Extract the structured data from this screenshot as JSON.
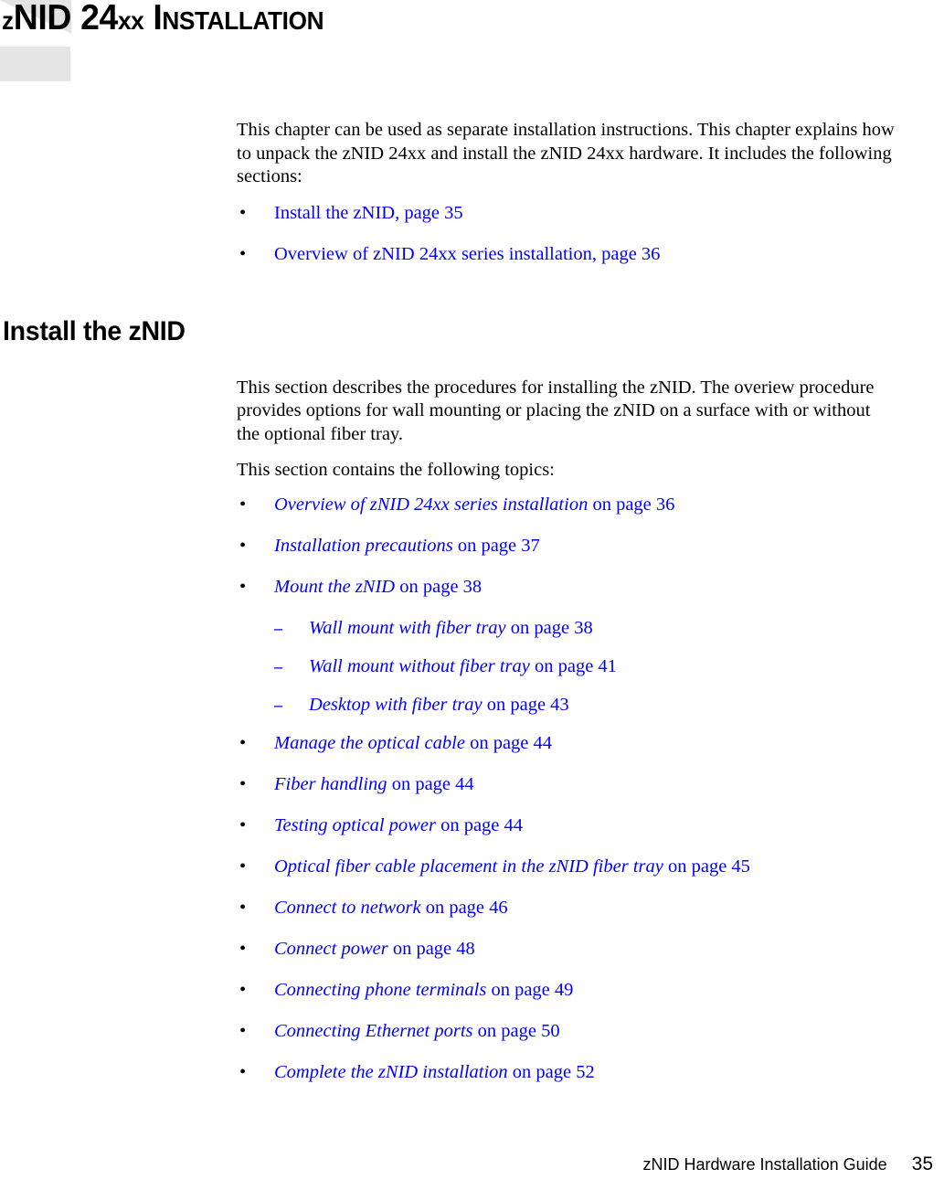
{
  "chapter": {
    "title_lead": "z",
    "title_main": "NID 24",
    "title_xx": "xx",
    "title_space": " ",
    "title_i": "I",
    "title_rest": "NSTALLATION",
    "title_full": "zNID 24xx Installation"
  },
  "intro": {
    "paragraph": "This chapter can be used as separate installation instructions. This chapter explains how to unpack the zNID 24xx and install the zNID 24xx hardware. It includes the following sections:",
    "links": [
      {
        "title": "Install the zNID, page 35"
      },
      {
        "title": "Overview of zNID 24xx series installation, page 36"
      }
    ]
  },
  "section": {
    "heading": "Install the zNID",
    "paragraph_1": "This section describes the procedures for installing the zNID. The overiew procedure provides options for wall mounting or placing the zNID on a surface with or without the optional fiber tray.",
    "paragraph_2": "This section contains the following topics:",
    "topics": [
      {
        "level": 1,
        "title": "Overview of zNID 24xx series installation",
        "page": " on page 36"
      },
      {
        "level": 1,
        "title": "Installation precautions",
        "page": " on page 37"
      },
      {
        "level": 1,
        "title": "Mount the zNID",
        "page": " on page 38"
      },
      {
        "level": 2,
        "title": "Wall mount with fiber tray",
        "page": " on page 38"
      },
      {
        "level": 2,
        "title": "Wall mount without fiber tray",
        "page": " on page 41"
      },
      {
        "level": 2,
        "title": "Desktop with fiber tray",
        "page": " on page 43"
      },
      {
        "level": 1,
        "title": "Manage the optical cable",
        "page": " on page 44"
      },
      {
        "level": 1,
        "title": "Fiber handling",
        "page": " on page 44"
      },
      {
        "level": 1,
        "title": "Testing optical power",
        "page": " on page 44"
      },
      {
        "level": 1,
        "title": "Optical fiber cable placement in the zNID fiber tray",
        "page": " on page 45"
      },
      {
        "level": 1,
        "title": "Connect to network",
        "page": " on page 46"
      },
      {
        "level": 1,
        "title": "Connect power",
        "page": " on page 48"
      },
      {
        "level": 1,
        "title": "Connecting phone terminals",
        "page": " on page 49"
      },
      {
        "level": 1,
        "title": "Connecting Ethernet ports",
        "page": " on page 50"
      },
      {
        "level": 1,
        "title": "Complete the zNID installation",
        "page": " on page 52"
      }
    ]
  },
  "markers": {
    "bullet": "•",
    "dash": "–"
  },
  "footer": {
    "guide": "zNID Hardware Installation Guide",
    "page_number": "35"
  },
  "colors": {
    "link": "#0000ff",
    "text": "#000000",
    "block": "#e5e5e5"
  }
}
